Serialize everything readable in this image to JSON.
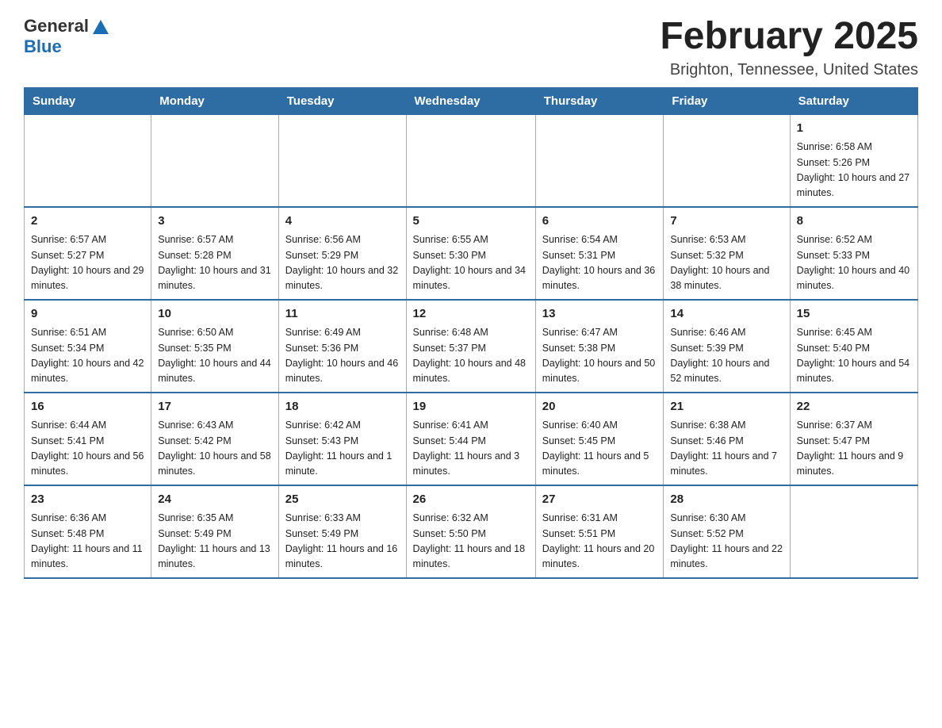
{
  "header": {
    "logo_general": "General",
    "logo_blue": "Blue",
    "month_title": "February 2025",
    "location": "Brighton, Tennessee, United States"
  },
  "weekdays": [
    "Sunday",
    "Monday",
    "Tuesday",
    "Wednesday",
    "Thursday",
    "Friday",
    "Saturday"
  ],
  "weeks": [
    [
      {
        "day": "",
        "info": ""
      },
      {
        "day": "",
        "info": ""
      },
      {
        "day": "",
        "info": ""
      },
      {
        "day": "",
        "info": ""
      },
      {
        "day": "",
        "info": ""
      },
      {
        "day": "",
        "info": ""
      },
      {
        "day": "1",
        "info": "Sunrise: 6:58 AM\nSunset: 5:26 PM\nDaylight: 10 hours and 27 minutes."
      }
    ],
    [
      {
        "day": "2",
        "info": "Sunrise: 6:57 AM\nSunset: 5:27 PM\nDaylight: 10 hours and 29 minutes."
      },
      {
        "day": "3",
        "info": "Sunrise: 6:57 AM\nSunset: 5:28 PM\nDaylight: 10 hours and 31 minutes."
      },
      {
        "day": "4",
        "info": "Sunrise: 6:56 AM\nSunset: 5:29 PM\nDaylight: 10 hours and 32 minutes."
      },
      {
        "day": "5",
        "info": "Sunrise: 6:55 AM\nSunset: 5:30 PM\nDaylight: 10 hours and 34 minutes."
      },
      {
        "day": "6",
        "info": "Sunrise: 6:54 AM\nSunset: 5:31 PM\nDaylight: 10 hours and 36 minutes."
      },
      {
        "day": "7",
        "info": "Sunrise: 6:53 AM\nSunset: 5:32 PM\nDaylight: 10 hours and 38 minutes."
      },
      {
        "day": "8",
        "info": "Sunrise: 6:52 AM\nSunset: 5:33 PM\nDaylight: 10 hours and 40 minutes."
      }
    ],
    [
      {
        "day": "9",
        "info": "Sunrise: 6:51 AM\nSunset: 5:34 PM\nDaylight: 10 hours and 42 minutes."
      },
      {
        "day": "10",
        "info": "Sunrise: 6:50 AM\nSunset: 5:35 PM\nDaylight: 10 hours and 44 minutes."
      },
      {
        "day": "11",
        "info": "Sunrise: 6:49 AM\nSunset: 5:36 PM\nDaylight: 10 hours and 46 minutes."
      },
      {
        "day": "12",
        "info": "Sunrise: 6:48 AM\nSunset: 5:37 PM\nDaylight: 10 hours and 48 minutes."
      },
      {
        "day": "13",
        "info": "Sunrise: 6:47 AM\nSunset: 5:38 PM\nDaylight: 10 hours and 50 minutes."
      },
      {
        "day": "14",
        "info": "Sunrise: 6:46 AM\nSunset: 5:39 PM\nDaylight: 10 hours and 52 minutes."
      },
      {
        "day": "15",
        "info": "Sunrise: 6:45 AM\nSunset: 5:40 PM\nDaylight: 10 hours and 54 minutes."
      }
    ],
    [
      {
        "day": "16",
        "info": "Sunrise: 6:44 AM\nSunset: 5:41 PM\nDaylight: 10 hours and 56 minutes."
      },
      {
        "day": "17",
        "info": "Sunrise: 6:43 AM\nSunset: 5:42 PM\nDaylight: 10 hours and 58 minutes."
      },
      {
        "day": "18",
        "info": "Sunrise: 6:42 AM\nSunset: 5:43 PM\nDaylight: 11 hours and 1 minute."
      },
      {
        "day": "19",
        "info": "Sunrise: 6:41 AM\nSunset: 5:44 PM\nDaylight: 11 hours and 3 minutes."
      },
      {
        "day": "20",
        "info": "Sunrise: 6:40 AM\nSunset: 5:45 PM\nDaylight: 11 hours and 5 minutes."
      },
      {
        "day": "21",
        "info": "Sunrise: 6:38 AM\nSunset: 5:46 PM\nDaylight: 11 hours and 7 minutes."
      },
      {
        "day": "22",
        "info": "Sunrise: 6:37 AM\nSunset: 5:47 PM\nDaylight: 11 hours and 9 minutes."
      }
    ],
    [
      {
        "day": "23",
        "info": "Sunrise: 6:36 AM\nSunset: 5:48 PM\nDaylight: 11 hours and 11 minutes."
      },
      {
        "day": "24",
        "info": "Sunrise: 6:35 AM\nSunset: 5:49 PM\nDaylight: 11 hours and 13 minutes."
      },
      {
        "day": "25",
        "info": "Sunrise: 6:33 AM\nSunset: 5:49 PM\nDaylight: 11 hours and 16 minutes."
      },
      {
        "day": "26",
        "info": "Sunrise: 6:32 AM\nSunset: 5:50 PM\nDaylight: 11 hours and 18 minutes."
      },
      {
        "day": "27",
        "info": "Sunrise: 6:31 AM\nSunset: 5:51 PM\nDaylight: 11 hours and 20 minutes."
      },
      {
        "day": "28",
        "info": "Sunrise: 6:30 AM\nSunset: 5:52 PM\nDaylight: 11 hours and 22 minutes."
      },
      {
        "day": "",
        "info": ""
      }
    ]
  ]
}
